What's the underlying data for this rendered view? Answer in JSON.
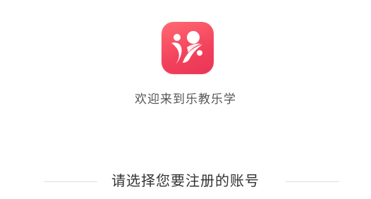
{
  "app": {
    "logo_icon": "leteachlearn-logo-icon",
    "brand_color": "#f2415c"
  },
  "welcome": {
    "text": "欢迎来到乐教乐学"
  },
  "account_select": {
    "prompt": "请选择您要注册的账号"
  }
}
